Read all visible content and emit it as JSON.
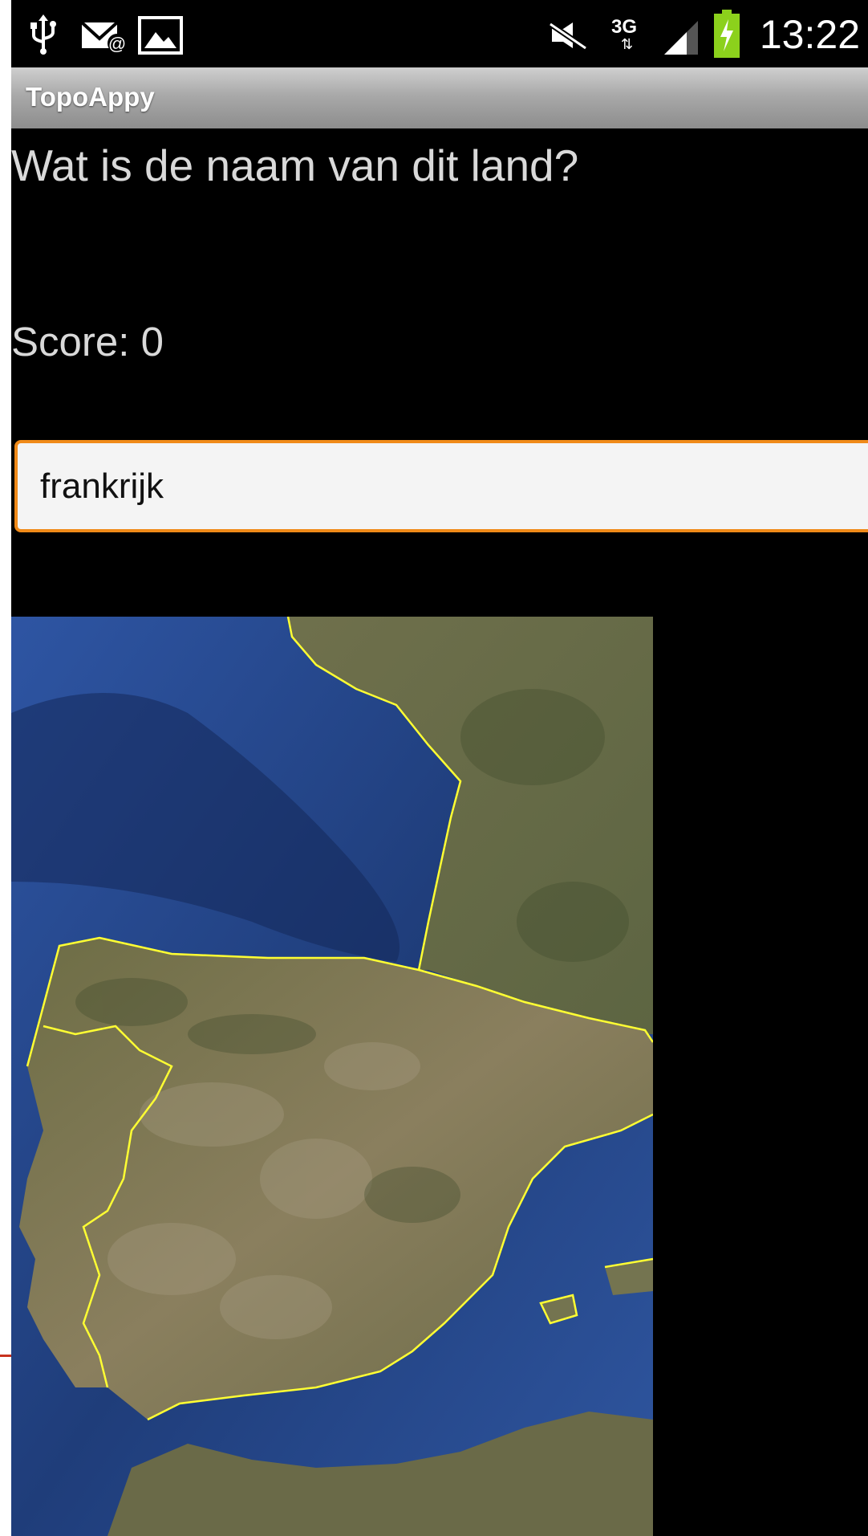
{
  "status_bar": {
    "time": "13:22",
    "network": "3G",
    "icons": [
      "usb-icon",
      "email-icon",
      "image-notification-icon",
      "mute-icon",
      "network-3g-icon",
      "signal-icon",
      "battery-charging-icon"
    ]
  },
  "app": {
    "title": "TopoAppy"
  },
  "quiz": {
    "question": "Wat is de naam van dit land?",
    "score": "Score: 0",
    "answer_value": "frankrijk"
  },
  "map": {
    "icon": "satellite-map-iberian-peninsula"
  },
  "colors": {
    "input_border": "#f08a19",
    "border_line": "#ffff33",
    "sea": "#2b4c8f",
    "land": "#7a7a52"
  }
}
